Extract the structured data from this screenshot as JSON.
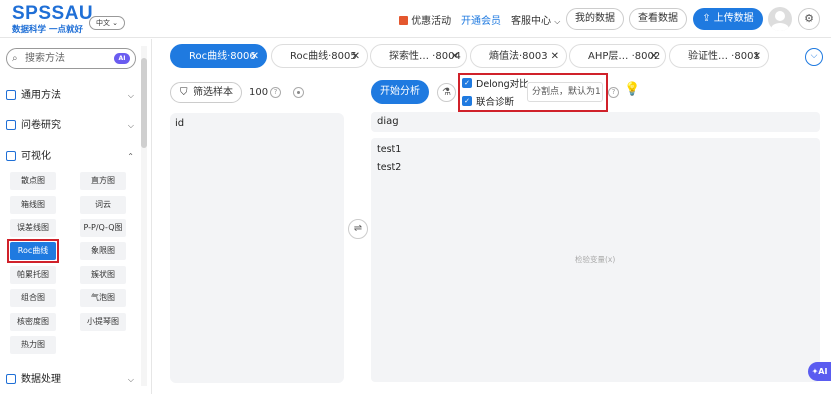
{
  "header": {
    "logo": "SPSSAU",
    "slogan": "数据科学 一点就好",
    "language": "中文",
    "promo": "优惠活动",
    "vip": "开通会员",
    "support": "客服中心",
    "my_data": "我的数据",
    "view_data": "查看数据",
    "upload": "上传数据"
  },
  "sidebar": {
    "search_placeholder": "搜索方法",
    "ai_badge": "AI",
    "sections": [
      "通用方法",
      "问卷研究",
      "可视化",
      "数据处理"
    ],
    "viz_items": [
      "散点图",
      "直方图",
      "箱线图",
      "词云",
      "误差线图",
      "P-P/Q-Q图",
      "Roc曲线",
      "象限图",
      "帕累托图",
      "簇状图",
      "组合图",
      "气泡图",
      "核密度图",
      "小提琴图",
      "热力图"
    ]
  },
  "tabs": [
    {
      "label": "Roc曲线·8006"
    },
    {
      "label": "Roc曲线·8005"
    },
    {
      "label": "探索性…  ·8004"
    },
    {
      "label": "熵值法·8003"
    },
    {
      "label": "AHP层…  ·8002"
    },
    {
      "label": "验证性…  ·8001"
    }
  ],
  "toolbar": {
    "filter": "筛选样本",
    "sample_count": "100",
    "start": "开始分析",
    "delong": "Delong对比",
    "joint": "联合诊断",
    "cutoff_placeholder": "分割点，默认为1"
  },
  "left_panel": {
    "items": [
      "id"
    ]
  },
  "right_panel": {
    "target": "diag",
    "vars": [
      "test1",
      "test2"
    ],
    "hint": "检验变量(x)"
  },
  "float_ai": "AI"
}
